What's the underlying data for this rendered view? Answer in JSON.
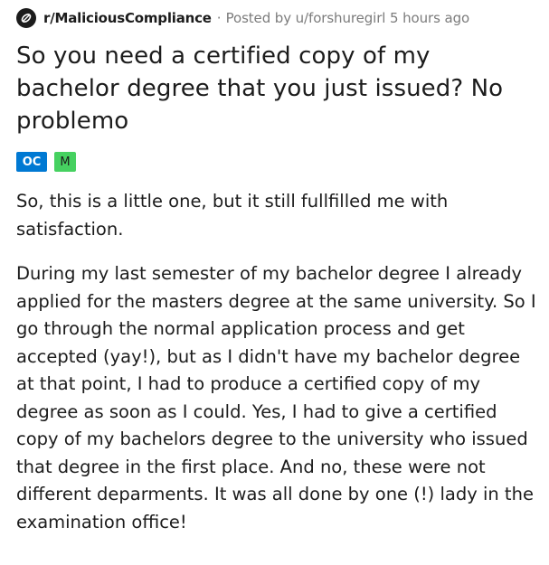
{
  "post": {
    "subreddit": "r/MaliciousCompliance",
    "separator": "·",
    "posted_by": "Posted by u/forshuregirl 5 hours ago",
    "title": "So you need a certified copy of my bachelor degree that you just issued? No problemo",
    "flairs": [
      {
        "label": "OC",
        "color": "#0079d3"
      },
      {
        "label": "M",
        "color": "#46d160"
      }
    ],
    "paragraphs": [
      "So, this is a little one, but it still fullfilled me with satisfaction.",
      "During my last semester of my bachelor degree I already applied for the masters degree at the same university. So I go through the normal application process and get accepted (yay!), but as I didn't have my bachelor degree at that point, I had to produce a certified copy of my degree as soon as I could. Yes, I had to give a certified copy of my bachelors degree to the university who issued that degree in the first place. And no, these were not different deparments. It was all done by one (!) lady in the examination office!"
    ]
  },
  "icons": {
    "subreddit_icon": "subreddit-icon"
  },
  "colors": {
    "text": "#1c1c1c",
    "meta": "#7c7c7c",
    "oc_flair": "#0079d3",
    "m_flair": "#46d160"
  }
}
